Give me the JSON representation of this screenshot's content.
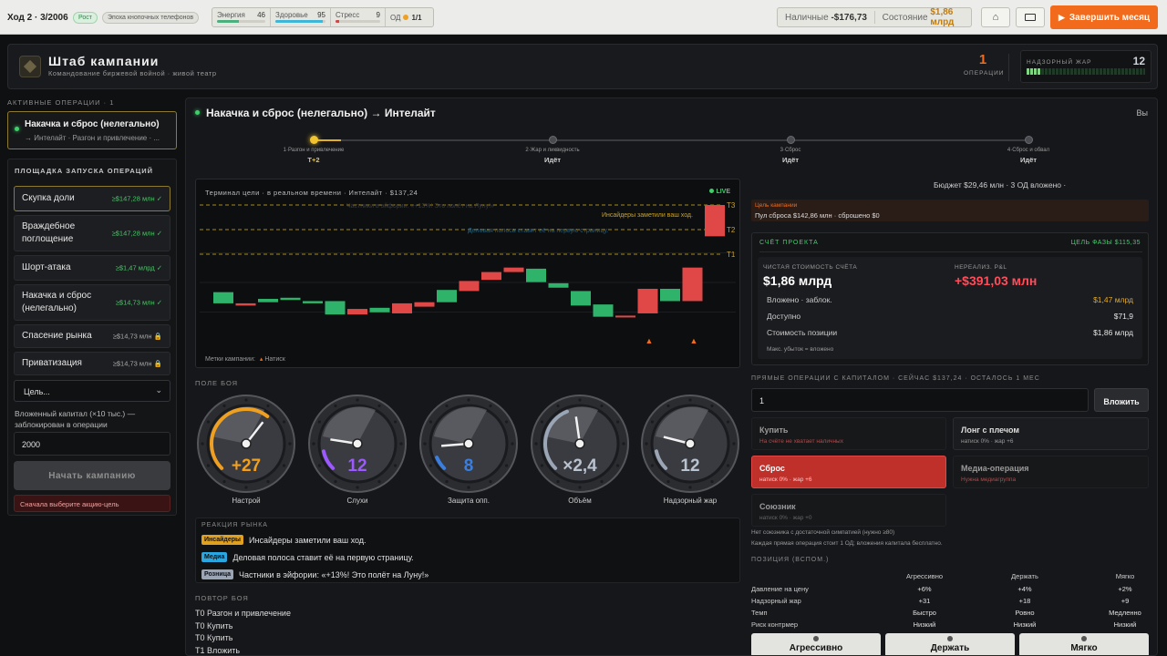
{
  "topbar": {
    "turn": "Ход 2 · 3/2006",
    "trend_badge": "Рост",
    "era_badge": "Эпоха кнопочных телефонов",
    "stats": [
      {
        "label": "Энергия",
        "value": "46",
        "level": 0.46,
        "color": "#4caf7d"
      },
      {
        "label": "Здоровье",
        "value": "95",
        "level": 0.95,
        "color": "#3fb5d8"
      },
      {
        "label": "Стресс",
        "value": "9",
        "level": 0.09,
        "color": "#d64545"
      }
    ],
    "od_label": "ОД",
    "od_value": "1/1",
    "cash_label": "Наличные",
    "cash_value": "-$176,73",
    "wealth_label": "Состояние",
    "wealth_value": "$1,86 млрд",
    "end_month": "Завершить месяц"
  },
  "header": {
    "title": "Штаб кампании",
    "subtitle": "Командование биржевой войной · живой театр",
    "ops_count": "1",
    "ops_label": "ОПЕРАЦИИ",
    "heat_label": "НАДЗОРНЫЙ ЖАР",
    "heat_value": "12",
    "heat_level": 0.12
  },
  "sidebar": {
    "active_label": "АКТИВНЫЕ ОПЕРАЦИИ · 1",
    "active_op": {
      "name": "Накачка и сброс (нелегально)",
      "sub": "→ Интелайт · Разгон и привлечение · ..."
    },
    "launch_label": "ПЛОЩАДКА ЗАПУСКА ОПЕРАЦИЙ",
    "ops": [
      {
        "name": "Скупка доли",
        "price": "≥$147,28 млн ✓"
      },
      {
        "name": "Враждебное поглощение",
        "price": "≥$147,28 млн ✓"
      },
      {
        "name": "Шорт-атака",
        "price": "≥$1,47 млрд ✓"
      },
      {
        "name": "Накачка и сброс (нелегально)",
        "price": "≥$14,73 млн ✓"
      },
      {
        "name": "Спасение рынка",
        "price": "≥$14,73 млн 🔒"
      },
      {
        "name": "Приватизация",
        "price": "≥$14,73 млн 🔒"
      }
    ],
    "target_select": "Цель...",
    "capital_label": "Вложенный капитал (×10 тыс.) — заблокирован в операции",
    "capital_value": "2000",
    "start_button": "Начать кампанию",
    "warning": "Сначала выберите акцию-цель"
  },
  "op": {
    "title": "Накачка и сброс (нелегально) → Интелайт",
    "right_cut": "Вы",
    "steps": [
      {
        "label": "1·Разгон и привлечение",
        "status": "T+2"
      },
      {
        "label": "2·Жар и ликвидность",
        "status": "Идёт"
      },
      {
        "label": "3·Сброс",
        "status": "Идёт"
      },
      {
        "label": "4·Сброс и обвал",
        "status": "Идёт"
      }
    ]
  },
  "terminal": {
    "title": "Терминал цели · в реальном времени · Интелайт · $137,24",
    "live": "LIVE",
    "line_labels": [
      "T3",
      "T2",
      "T1"
    ],
    "annotations": [
      "Инсайдеры заметили ваш ход.",
      "Частники в эйфории: «+13%! Это полёт на Луну!»",
      "Деловая полоса ставит её на первую страницу."
    ],
    "legend_label": "Метки кампании:",
    "legend_item": "Натиск"
  },
  "chart_data": {
    "type": "candlestick",
    "title": "Терминал цели · в реальном времени · Интелайт · $137,24",
    "candles": [
      {
        "open": 0.22,
        "close": 0.12,
        "dir": "up"
      },
      {
        "open": 0.12,
        "close": 0.1,
        "dir": "down"
      },
      {
        "open": 0.13,
        "close": 0.16,
        "dir": "up"
      },
      {
        "open": 0.15,
        "close": 0.17,
        "dir": "up"
      },
      {
        "open": 0.12,
        "close": 0.14,
        "dir": "up"
      },
      {
        "open": 0.02,
        "close": 0.14,
        "dir": "up"
      },
      {
        "open": 0.07,
        "close": 0.02,
        "dir": "down"
      },
      {
        "open": 0.04,
        "close": 0.08,
        "dir": "up"
      },
      {
        "open": 0.12,
        "close": 0.03,
        "dir": "down"
      },
      {
        "open": 0.13,
        "close": 0.09,
        "dir": "down"
      },
      {
        "open": 0.13,
        "close": 0.24,
        "dir": "up"
      },
      {
        "open": 0.23,
        "close": 0.32,
        "dir": "down"
      },
      {
        "open": 0.33,
        "close": 0.4,
        "dir": "down"
      },
      {
        "open": 0.44,
        "close": 0.4,
        "dir": "down"
      },
      {
        "open": 0.43,
        "close": 0.31,
        "dir": "up"
      },
      {
        "open": 0.3,
        "close": 0.26,
        "dir": "up"
      },
      {
        "open": 0.23,
        "close": 0.1,
        "dir": "up"
      },
      {
        "open": 0.11,
        "close": 0.0,
        "dir": "up"
      },
      {
        "open": 0.0,
        "close": 0.01,
        "dir": "down"
      },
      {
        "open": 0.03,
        "close": 0.25,
        "dir": "down"
      },
      {
        "open": 0.25,
        "close": 0.14,
        "dir": "up"
      },
      {
        "open": 0.14,
        "close": 0.44,
        "dir": "down"
      },
      {
        "open": 0.72,
        "close": 1.0,
        "dir": "down"
      }
    ],
    "levels": [
      {
        "name": "T3",
        "value": 1.0
      },
      {
        "name": "T2",
        "value": 0.78
      },
      {
        "name": "T1",
        "value": 0.56
      }
    ],
    "markers": [
      19,
      21
    ]
  },
  "battlefield": {
    "label": "ПОЛЕ БОЯ",
    "gauges": [
      {
        "value": "+27",
        "label": "Настрой",
        "color": "#f0a020",
        "level": 0.64,
        "needle": 0.64
      },
      {
        "value": "12",
        "label": "Слухи",
        "color": "#9b59ff",
        "level": 0.12,
        "needle": 0.2
      },
      {
        "value": "8",
        "label": "Защита опп.",
        "color": "#3a7fe0",
        "level": 0.08,
        "needle": 0.15
      },
      {
        "value": "×2,4",
        "label": "Объём",
        "color": "#9aa5b5",
        "level": 0.42,
        "needle": 0.47
      },
      {
        "value": "12",
        "label": "Надзорный жар",
        "color": "#9aa5b5",
        "level": 0.12,
        "needle": 0.22
      }
    ]
  },
  "reaction": {
    "label": "РЕАКЦИЯ РЫНКА",
    "rows": [
      {
        "tag": "Инсайдеры",
        "color": "#e0a020",
        "text": "Инсайдеры заметили ваш ход."
      },
      {
        "tag": "Медиа",
        "color": "#2aa7e0",
        "text": "Деловая полоса ставит её на первую страницу."
      },
      {
        "tag": "Розница",
        "color": "#9aa5b5",
        "text": "Частники в эйфории: «+13%! Это полёт на Луну!»"
      }
    ]
  },
  "replay": {
    "label": "ПОВТОР БОЯ",
    "rows": [
      "T0 Разгон и привлечение",
      "T0 Купить",
      "T0 Купить",
      "T1 Вложить"
    ]
  },
  "right": {
    "budget": "Бюджет $29,46 млн · 3 ОД вложено ·",
    "goal_label": "Цель кампании",
    "goal_text": "Пул сброса $142,86 млн · сброшено $0",
    "account_label": "СЧЁТ ПРОЕКТА",
    "phase_goal": "ЦЕЛЬ ФАЗЫ $115,35",
    "net_label": "ЧИСТАЯ СТОИМОСТЬ СЧЁТА",
    "net_value": "$1,86 млрд",
    "pnl_label": "НЕРЕАЛИЗ. P&L",
    "pnl_value": "+$391,03 млн",
    "rows": [
      {
        "label": "Вложено · заблок.",
        "value": "$1,47 млрд",
        "color": "#e0a92a"
      },
      {
        "label": "Доступно",
        "value": "$71,9",
        "color": "#e6e6e6"
      },
      {
        "label": "Стоимость позиции",
        "value": "$1,86 млрд",
        "color": "#e6e6e6"
      }
    ],
    "max_loss": "Макс. убыток = вложено",
    "direct_label": "ПРЯМЫЕ ОПЕРАЦИИ С КАПИТАЛОМ · СЕЙЧАС $137,24 · ОСТАЛОСЬ 1 МЕС",
    "direct_value": "1",
    "invest_button": "Вложить",
    "actions": [
      {
        "title": "Купить",
        "sub": "На счёте не хватает наличных"
      },
      {
        "title": "Лонг с плечом",
        "sub": "натиск 0% · жар +6"
      },
      {
        "title": "Сброс",
        "sub": "натиск 0% · жар +6"
      },
      {
        "title": "Медиа-операция",
        "sub": "Нужна медиагруппа"
      },
      {
        "title": "Союзник",
        "sub": "натиск 0% · жар +0"
      }
    ],
    "note1": "Нет союзника с достаточной симпатией (нужно ≥80)",
    "note2": "Каждая прямая операция стоит 1 ОД; вложения капитала бесплатно.",
    "position_label": "ПОЗИЦИЯ (ВСПОМ.)",
    "position_cols": [
      "Агрессивно",
      "Держать",
      "Мягко"
    ],
    "position_rows": [
      {
        "label": "Давление на цену",
        "vals": [
          "+6%",
          "+4%",
          "+2%"
        ]
      },
      {
        "label": "Надзорный жар",
        "vals": [
          "+31",
          "+18",
          "+9"
        ]
      },
      {
        "label": "Темп",
        "vals": [
          "Быстро",
          "Ровно",
          "Медленно"
        ]
      },
      {
        "label": "Риск контрмер",
        "vals": [
          "Низкий",
          "Низкий",
          "Низкий"
        ]
      }
    ],
    "position_buttons": [
      "Агрессивно",
      "Держать",
      "Мягко"
    ]
  },
  "colors": {
    "accent": "#f26a1b",
    "up": "#2fb36a",
    "down": "#e04848",
    "gold": "#e0a92a"
  }
}
